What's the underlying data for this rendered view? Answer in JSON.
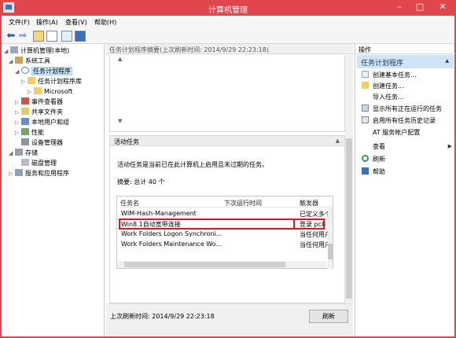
{
  "window": {
    "title": "计算机管理"
  },
  "menu": [
    "文件(F)",
    "操作(A)",
    "查看(V)",
    "帮助(H)"
  ],
  "tree": {
    "root": "计算机管理(本地)",
    "system_tools": "系统工具",
    "task_scheduler": "任务计划程序",
    "task_library": "任务计划程序库",
    "microsoft": "Microsoft",
    "event_viewer": "事件查看器",
    "shared_folders": "共享文件夹",
    "local_users": "本地用户和组",
    "performance": "性能",
    "device_manager": "设备管理器",
    "storage": "存储",
    "disk_management": "磁盘管理",
    "services": "服务和应用程序"
  },
  "center": {
    "header": "任务计划程序摘要(上次刷新时间: 2014/9/29 22:23:18)",
    "active_section": "活动任务",
    "description": "活动任务是当前已在此计算机上启用且未过期的任务。",
    "summary": "摘要: 总计 40 个",
    "columns": [
      "任务名",
      "下次运行时间",
      "触发器"
    ],
    "rows": [
      {
        "name": "WIM-Hash-Management",
        "next": "",
        "trigger": "已定义多个"
      },
      {
        "name": "Win8.1自动宽带连接",
        "next": "",
        "trigger": "登录 pc8"
      },
      {
        "name": "Work Folders Logon Synchroni...",
        "next": "",
        "trigger": "当任何用户"
      },
      {
        "name": "Work Folders Maintenance Wo...",
        "next": "",
        "trigger": "当任何用户"
      }
    ],
    "last_refresh": "上次刷新时间: 2014/9/29 22:23:18",
    "refresh_button": "刷新"
  },
  "actions": {
    "header": "操作",
    "section": "任务计划程序",
    "items": [
      {
        "label": "创建基本任务...",
        "icon": "create-basic-task-icon"
      },
      {
        "label": "创建任务...",
        "icon": "create-task-icon"
      },
      {
        "label": "导入任务...",
        "icon": ""
      },
      {
        "label": "显示所有正在运行的任务",
        "icon": "running-tasks-icon"
      },
      {
        "label": "启用所有任务历史记录",
        "icon": "history-icon"
      },
      {
        "label": "AT 服务帐户配置",
        "icon": ""
      },
      {
        "label": "查看",
        "icon": ""
      },
      {
        "label": "刷新",
        "icon": "refresh-icon"
      },
      {
        "label": "帮助",
        "icon": "help-icon"
      }
    ]
  },
  "colors": {
    "title_bar": "#e0474c",
    "selection": "#cde8ff",
    "highlight_box": "#d71920"
  }
}
